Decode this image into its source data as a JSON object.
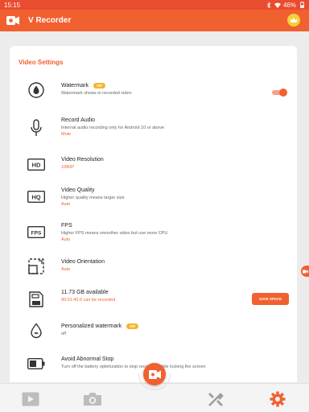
{
  "status_bar": {
    "time": "15:15",
    "battery": "46%"
  },
  "app_bar": {
    "title": "V Recorder"
  },
  "settings": {
    "section_title": "Video Settings",
    "watermark": {
      "title": "Watermark",
      "badge": "VIP",
      "desc": "Watermark shows in recorded video",
      "enabled": true
    },
    "record_audio": {
      "title": "Record Audio",
      "desc": "Internal audio recording only for Android 10 or above",
      "value": "Mute"
    },
    "resolution": {
      "title": "Video Resolution",
      "value": "1080P",
      "icon_text": "HD"
    },
    "quality": {
      "title": "Video Quality",
      "desc": "Higher quality means larger size",
      "value": "Auto",
      "icon_text": "HQ"
    },
    "fps": {
      "title": "FPS",
      "desc": "Higher FPS means smoother video but use more CPU",
      "value": "Auto",
      "icon_text": "FPS"
    },
    "orientation": {
      "title": "Video Orientation",
      "value": "Auto"
    },
    "storage": {
      "title": "11.73 GB available",
      "value": "00:01:40.0 can be recorded",
      "button": "SAVE SPACE"
    },
    "personalized_watermark": {
      "title": "Personalized watermark",
      "badge": "VIP",
      "value": "off"
    },
    "abnormal_stop": {
      "title": "Avoid Abnormal Stop",
      "desc": "Turn off the battery optimization to stop recording while locking the screen"
    }
  },
  "bottom_nav": [
    "video-icon",
    "camera-icon",
    "tools-icon",
    "settings-icon"
  ],
  "colors": {
    "accent": "#f1602f",
    "status_bar": "#ea4c2f",
    "vip": "#f4b528"
  }
}
